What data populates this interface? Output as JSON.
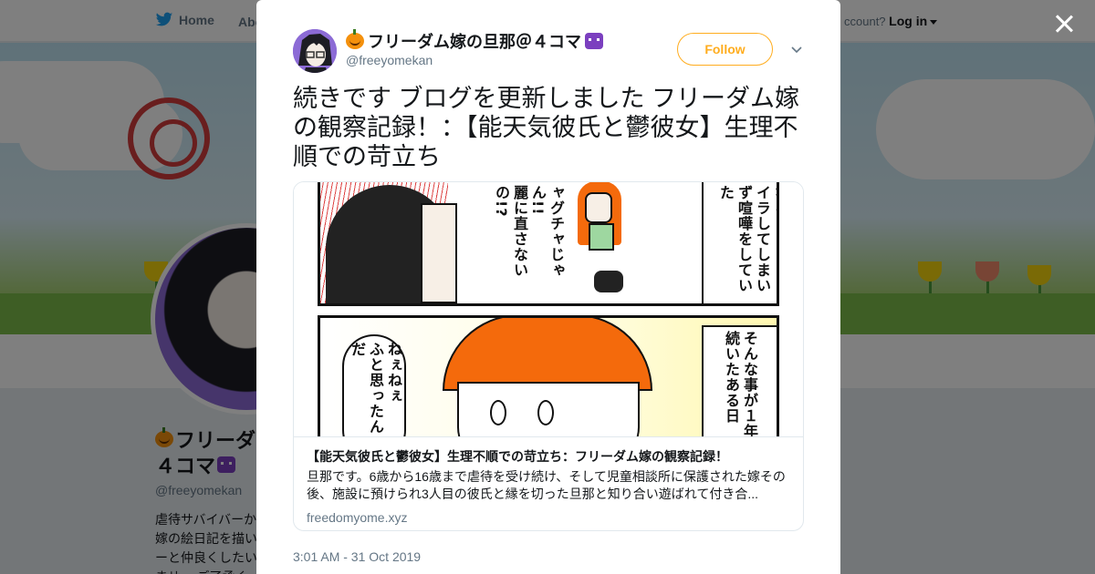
{
  "nav": {
    "home_label": "Home",
    "about_label": "Abo",
    "account_prompt": "ccount?",
    "login_label": "Log in"
  },
  "profile": {
    "name": "フリーダ\n４コマ",
    "handle": "@freeyomekan",
    "bio": "虐待サバイバーか嫁の絵日記を描いーと仲良くしたいませ… ご了承く"
  },
  "tweet": {
    "author_name": "フリーダム嫁の旦那＠４コマ",
    "author_handle": "@freeyomekan",
    "follow_label": "Follow",
    "text": "続きです ブログを更新しました フリーダム嫁の観察記録！：【能天気彼氏と鬱彼女】生理不順での苛立ち",
    "timestamp": "3:01 AM - 31 Oct 2019",
    "card": {
      "title": "【能天気彼氏と鬱彼女】生理不順での苛立ち：フリーダム嫁の観察記録！",
      "description": "旦那です。6歳から16歳まで虐待を受け続け、そして児童相談所に保護された嫁その後、施設に預けられ3人目の彼氏と縁を切った旦那と知り合い遊ばれて付き合...",
      "domain": "freedomyome.xyz",
      "manga": {
        "panel1_speech": "ャグチャじゃん!!\n麗に直さないの!?",
        "panel1_narration": "なると\nイラしてしまい\nず喧嘩をしていた",
        "panel2_speech": "ねぇねぇ\nふと思ったんだ",
        "panel2_narration": "そんな事が１年\n続いたある日"
      }
    }
  },
  "colors": {
    "follow_accent": "#ffad1f",
    "twitter_blue": "#1da1f2",
    "overlay": "rgba(0,0,0,0.5)"
  },
  "icons": [
    "twitter-bird-icon",
    "caret-down-icon",
    "close-icon",
    "chevron-down-icon",
    "pumpkin-emoji-icon",
    "space-invader-emoji-icon"
  ]
}
